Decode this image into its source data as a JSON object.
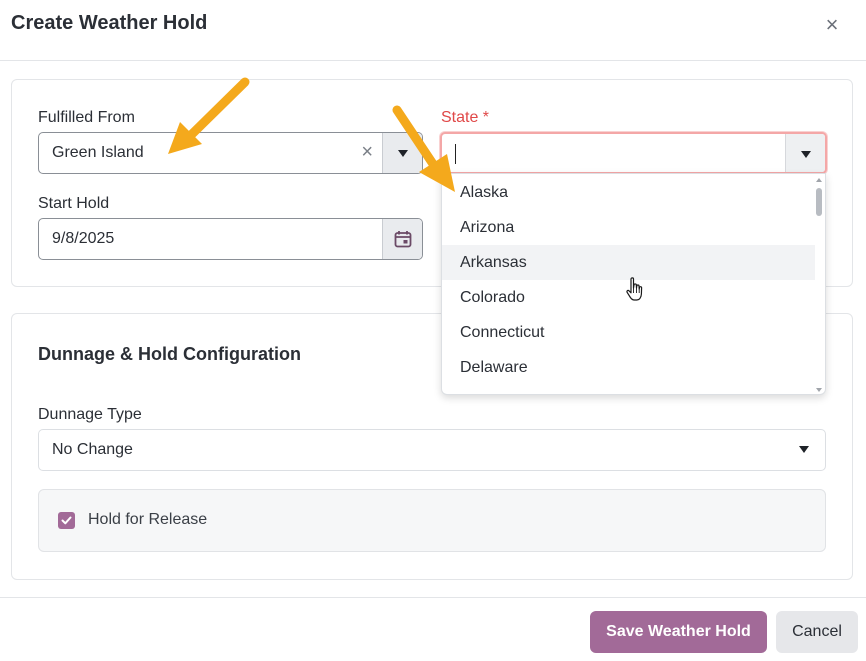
{
  "modal": {
    "title": "Create Weather Hold",
    "close_glyph": "×"
  },
  "fulfilled_from": {
    "label": "Fulfilled From",
    "value": "Green Island",
    "clear_glyph": "×"
  },
  "state": {
    "label": "State *",
    "value": "",
    "options": [
      "Alaska",
      "Arizona",
      "Arkansas",
      "Colorado",
      "Connecticut",
      "Delaware"
    ],
    "hovered_option": "Arkansas"
  },
  "start_hold": {
    "label": "Start Hold",
    "value": "9/8/2025"
  },
  "dunnage_section": {
    "title": "Dunnage & Hold Configuration",
    "type_label": "Dunnage Type",
    "type_value": "No Change"
  },
  "hold_for_release": {
    "label": "Hold for Release",
    "checked": true
  },
  "footer": {
    "save_label": "Save Weather Hold",
    "cancel_label": "Cancel"
  },
  "colors": {
    "accent": "#a26a98",
    "required": "#e04848",
    "annotation_arrow": "#f4a91c"
  },
  "icons": {
    "close": "close-icon",
    "clear": "clear-icon",
    "dropdown": "chevron-down-icon",
    "calendar": "calendar-icon",
    "check": "check-icon",
    "pointer": "hand-pointer-icon",
    "annotation": "annotation-arrow-icon"
  }
}
